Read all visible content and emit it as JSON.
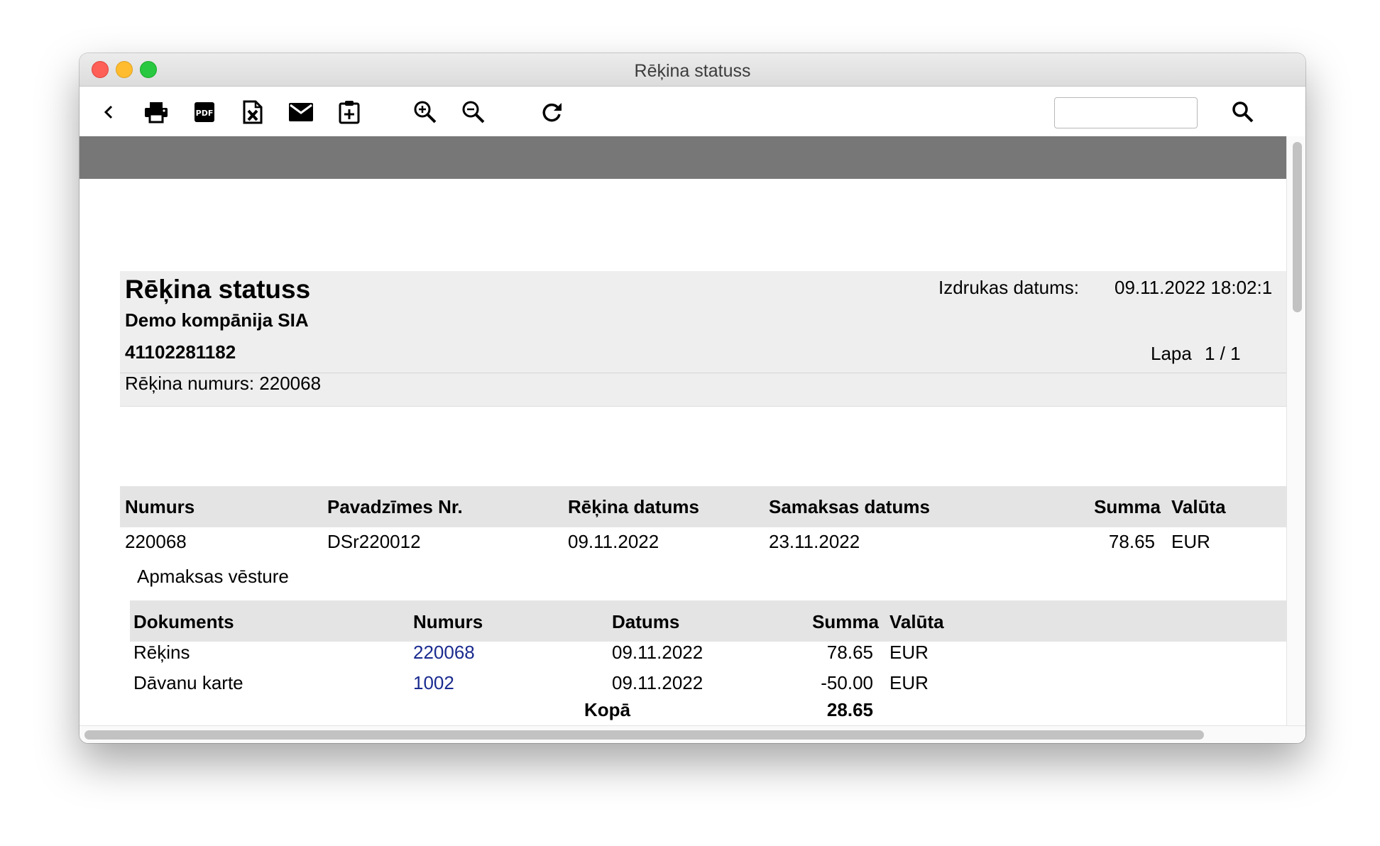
{
  "window": {
    "title": "Rēķina statuss"
  },
  "toolbar": {
    "buttons": [
      {
        "name": "back",
        "icon": "chevron-left-icon"
      },
      {
        "name": "print",
        "icon": "printer-icon"
      },
      {
        "name": "pdf",
        "icon": "pdf-icon"
      },
      {
        "name": "excel",
        "icon": "excel-icon"
      },
      {
        "name": "email",
        "icon": "envelope-icon"
      },
      {
        "name": "clipboard",
        "icon": "clipboard-add-icon"
      },
      {
        "name": "zoom-in",
        "icon": "zoom-in-icon"
      },
      {
        "name": "zoom-out",
        "icon": "zoom-out-icon"
      },
      {
        "name": "refresh",
        "icon": "refresh-icon"
      }
    ],
    "search_value": "",
    "search_icon": "search-icon"
  },
  "report": {
    "title": "Rēķina statuss",
    "company": "Demo kompānija SIA",
    "reg_no": "41102281182",
    "invoice_label": "Rēķina numurs: 220068",
    "print_date_label": "Izdrukas datums:",
    "print_date_value": "09.11.2022 18:02:1",
    "page_label": "Lapa",
    "page_value": "1 / 1"
  },
  "invoice_table": {
    "columns": [
      "Numurs",
      "Pavadzīmes Nr.",
      "Rēķina datums",
      "Samaksas datums",
      "Summa",
      "Valūta"
    ],
    "rows": [
      [
        "220068",
        "DSr220012",
        "09.11.2022",
        "23.11.2022",
        "78.65",
        "EUR"
      ]
    ]
  },
  "payment_history": {
    "label": "Apmaksas vēsture",
    "columns": [
      "Dokuments",
      "Numurs",
      "Datums",
      "Summa",
      "Valūta"
    ],
    "rows": [
      [
        "Rēķins",
        "220068",
        "09.11.2022",
        "78.65",
        "EUR"
      ],
      [
        "Dāvanu karte",
        "1002",
        "09.11.2022",
        "-50.00",
        "EUR"
      ]
    ],
    "total_label": "Kopā",
    "total_value": "28.65"
  },
  "colors": {
    "link": "#1a2b8f",
    "band": "#777777",
    "header_bg": "#e4e4e4"
  }
}
